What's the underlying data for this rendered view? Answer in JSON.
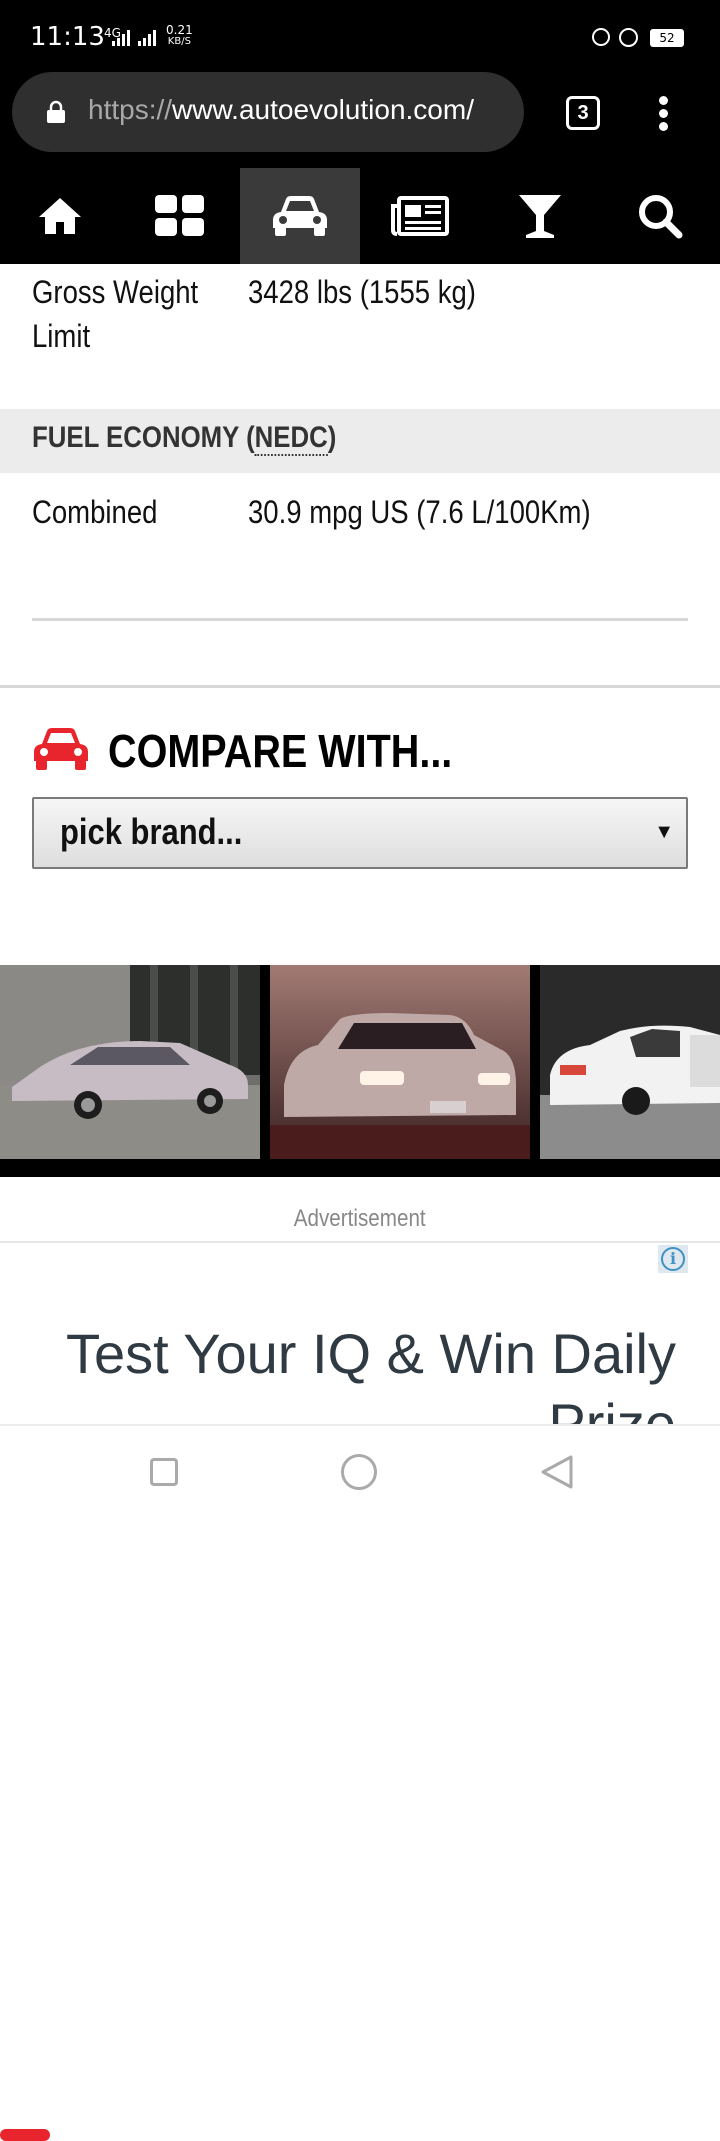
{
  "status_bar": {
    "time": "11:13",
    "network": "4G",
    "speed_value": "0.21",
    "speed_unit": "KB/S",
    "battery": "52"
  },
  "browser": {
    "url_scheme": "https://",
    "url_host": "www.autoevolution.com/",
    "tab_count": "3"
  },
  "site_nav": {
    "items": [
      {
        "icon": "home-icon"
      },
      {
        "icon": "grid-icon"
      },
      {
        "icon": "car-icon",
        "active": true
      },
      {
        "icon": "news-icon"
      },
      {
        "icon": "cocktail-icon"
      },
      {
        "icon": "search-icon"
      }
    ]
  },
  "specs": {
    "gross_weight_label_line1": "Gross Weight",
    "gross_weight_label_line2": "Limit",
    "gross_weight_value": "3428 lbs (1555 kg)",
    "fuel_section_title": "FUEL ECONOMY (",
    "fuel_section_abbr": "NEDC",
    "fuel_section_close": ")",
    "combined_label": "Combined",
    "combined_value": "30.9 mpg US (7.6 L/100Km)"
  },
  "compare": {
    "title": "COMPARE WITH...",
    "select_value": "pick brand...",
    "select_arrow": "▼"
  },
  "ad": {
    "label": "Advertisement",
    "text": "Test Your IQ & Win Daily Prize",
    "info_glyph": "i"
  },
  "colors": {
    "accent_red": "#e8242c",
    "nav_bg": "#000000",
    "nav_active": "#3a3a3a"
  }
}
